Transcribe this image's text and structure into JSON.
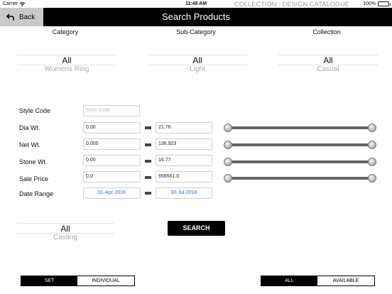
{
  "status_bar": {
    "carrier": "Carrier",
    "time": "11:48 AM",
    "battery": "100%"
  },
  "collection_header": "COLLECTION : DESIGN CATALOGUE",
  "nav": {
    "back_label": "Back",
    "title": "Search Products"
  },
  "pickers": {
    "category": {
      "label": "Category",
      "selected": "All",
      "next": "Womens Ring"
    },
    "sub_category": {
      "label": "Sub-Category",
      "selected": "All",
      "next": "Light"
    },
    "collection": {
      "label": "Collection",
      "selected": "All",
      "next": "Casual"
    },
    "metal": {
      "selected": "All",
      "next": "Casting"
    }
  },
  "form": {
    "style_code": {
      "label": "Style Code",
      "placeholder": "Style Code"
    },
    "dia_wt": {
      "label": "Dia Wt.",
      "min": "0.00",
      "max": "21.76"
    },
    "net_wt": {
      "label": "Net Wt.",
      "min": "0.000",
      "max": "136.923"
    },
    "stone_wt": {
      "label": "Stone Wt.",
      "min": "0.00",
      "max": "16.77"
    },
    "sale_price": {
      "label": "Sale Price",
      "min": "0.0",
      "max": "656561.0"
    },
    "date_range": {
      "label": "Date Range",
      "from": "01-Apr-2016",
      "to": "30-Jul-2016"
    }
  },
  "search_button": "SEARCH",
  "view_mode": {
    "options": [
      "SET",
      "INDIVIDUAL"
    ],
    "selected": "SET"
  },
  "availability": {
    "options": [
      "ALL",
      "AVAILABLE"
    ],
    "selected": "ALL"
  }
}
